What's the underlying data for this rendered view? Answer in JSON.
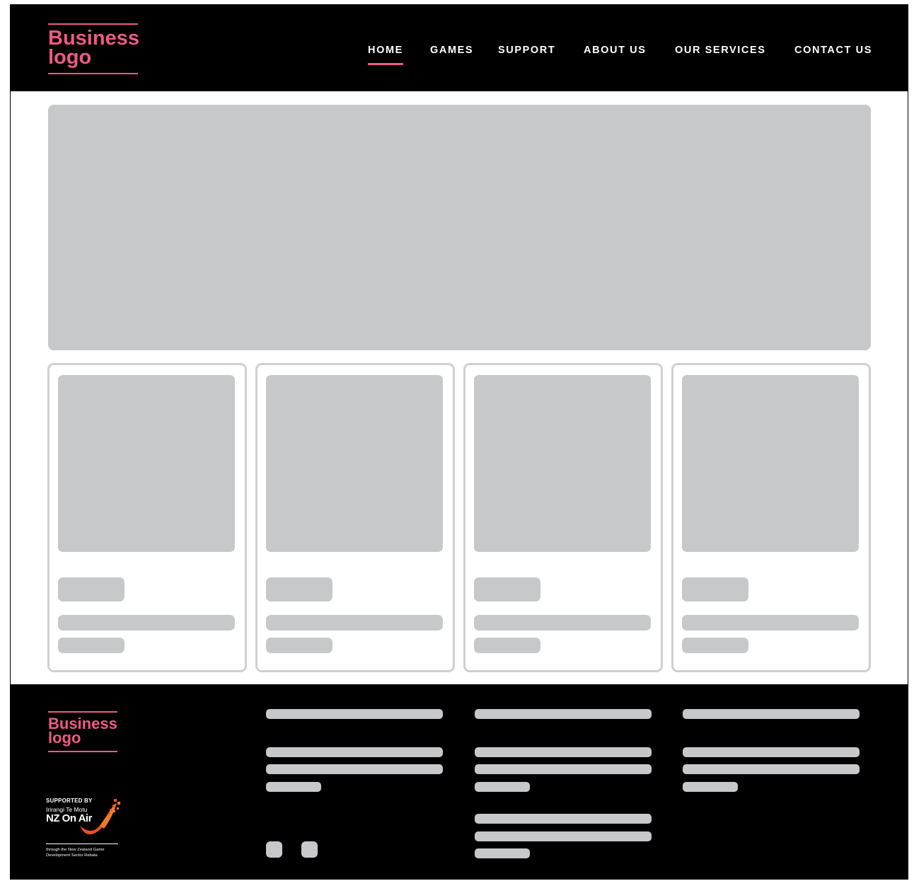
{
  "header": {
    "logo_text": "Business logo",
    "nav": [
      {
        "label": "HOME",
        "active": true
      },
      {
        "label": "GAMES",
        "active": false
      },
      {
        "label": "SUPPORT",
        "active": false
      },
      {
        "label": "ABOUT US",
        "active": false
      },
      {
        "label": "OUR SERVICES",
        "active": false
      },
      {
        "label": "CONTACT US",
        "active": false
      }
    ]
  },
  "footer": {
    "logo_text": "Business logo",
    "badge": {
      "supported_by": "SUPPORTED BY",
      "funder_maori": "Irirangi Te Motu",
      "funder": "NZ On Air",
      "rebate_line1": "through the New Zealand Game",
      "rebate_line2": "Development Sector Rebate"
    }
  },
  "colors": {
    "brand": "#ee5a84",
    "header_bg": "#000000",
    "placeholder": "#c7c8ca",
    "card_border": "#d0d0d2"
  }
}
